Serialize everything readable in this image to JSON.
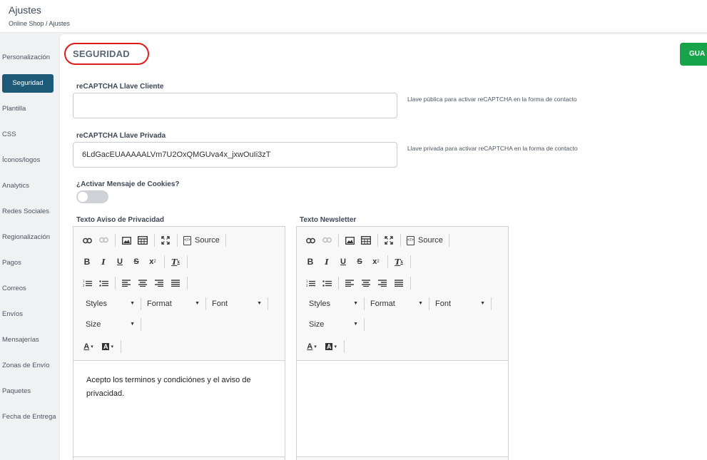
{
  "header": {
    "title": "Ajustes",
    "breadcrumb": "Online Shop / Ajustes"
  },
  "sidebar": {
    "items": [
      {
        "label": "Personalización"
      },
      {
        "label": "Seguridad",
        "active": true
      },
      {
        "label": "Plantilla"
      },
      {
        "label": "CSS"
      },
      {
        "label": "Íconos/logos"
      },
      {
        "label": "Analytics"
      },
      {
        "label": "Redes Sociales"
      },
      {
        "label": "Regionalización"
      },
      {
        "label": "Pagos"
      },
      {
        "label": "Correos"
      },
      {
        "label": "Envíos"
      },
      {
        "label": "Mensajerías"
      },
      {
        "label": "Zonas de Envío"
      },
      {
        "label": "Paquetes"
      },
      {
        "label": "Fecha de Entrega"
      }
    ]
  },
  "section": {
    "title": "SEGURIDAD",
    "save_label": "GUA"
  },
  "form": {
    "recaptcha_client": {
      "label": "reCAPTCHA Llave Cliente",
      "value": "",
      "help": "Llave pública para activar reCAPTCHA en la forma de contacto"
    },
    "recaptcha_private": {
      "label": "reCAPTCHA Llave Privada",
      "value": "6LdGacEUAAAAALVm7U2OxQMGUva4x_jxwOuIi3zT",
      "help": "Llave privada para activar reCAPTCHA en la forma de contacto"
    },
    "cookies": {
      "label": "¿Activar Mensaje de Cookies?",
      "enabled": false
    },
    "privacy_editor": {
      "label": "Texto Aviso de Privacidad",
      "content": "Acepto los terminos y condiciónes y el aviso de privacidad."
    },
    "newsletter_editor": {
      "label": "Texto Newsletter",
      "content": ""
    }
  },
  "editor_toolbar": {
    "source": "Source",
    "styles": "Styles",
    "format": "Format",
    "font": "Font",
    "size": "Size",
    "icons": [
      "link-icon",
      "unlink-icon",
      "image-icon",
      "table-icon",
      "maximize-icon",
      "source-icon",
      "bold-icon",
      "italic-icon",
      "underline-icon",
      "strikethrough-icon",
      "subscript-icon",
      "remove-format-icon",
      "numbered-list-icon",
      "bulleted-list-icon",
      "align-left-icon",
      "align-center-icon",
      "align-right-icon",
      "align-justify-icon",
      "text-color-icon",
      "background-color-icon"
    ]
  },
  "colors": {
    "active_nav": "#1e5a78",
    "save_button": "#16a34a",
    "highlight_ring": "#e01b1b"
  }
}
